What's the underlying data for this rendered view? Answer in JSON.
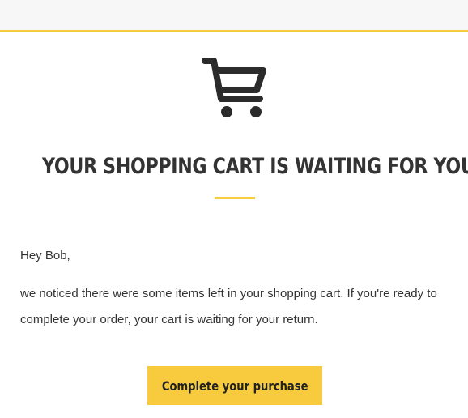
{
  "email": {
    "icon": "shopping-cart-icon",
    "headline": "YOUR SHOPPING CART IS WAITING FOR YOU",
    "greeting": "Hey Bob,",
    "body": "we noticed there were some items left in your shopping cart. If you're ready to complete your order, your cart is waiting for your return.",
    "cta_label": "Complete your purchase"
  },
  "colors": {
    "accent": "#f8cb3e",
    "text": "#333333",
    "header_background": "#f7f7f7"
  }
}
